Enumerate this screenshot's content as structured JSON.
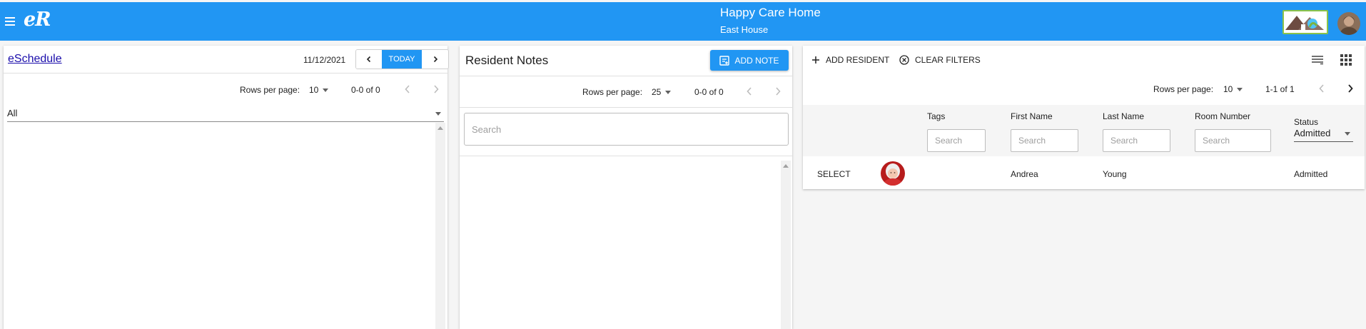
{
  "header": {
    "logo_text": "eR",
    "home_name": "Happy Care Home",
    "house_name": "East House",
    "brand_color": "#2196f3"
  },
  "schedule_panel": {
    "title": "eSchedule",
    "date": "11/12/2021",
    "today_label": "TODAY",
    "rows_per_page_label": "Rows per page:",
    "rows_per_page_value": "10",
    "range_text": "0-0 of 0",
    "filter_value": "All"
  },
  "notes_panel": {
    "title": "Resident Notes",
    "add_note_label": "ADD NOTE",
    "rows_per_page_label": "Rows per page:",
    "rows_per_page_value": "25",
    "range_text": "0-0 of 0",
    "search_placeholder": "Search"
  },
  "residents_panel": {
    "add_resident_label": "ADD RESIDENT",
    "clear_filters_label": "CLEAR FILTERS",
    "rows_per_page_label": "Rows per page:",
    "rows_per_page_value": "10",
    "range_text": "1-1 of 1",
    "columns": {
      "tags": "Tags",
      "first_name": "First Name",
      "last_name": "Last Name",
      "room_number": "Room Number",
      "status": "Status"
    },
    "filter_placeholder": "Search",
    "status_filter_value": "Admitted",
    "rows": [
      {
        "select_label": "SELECT",
        "first_name": "Andrea",
        "last_name": "Young",
        "status": "Admitted"
      }
    ]
  }
}
